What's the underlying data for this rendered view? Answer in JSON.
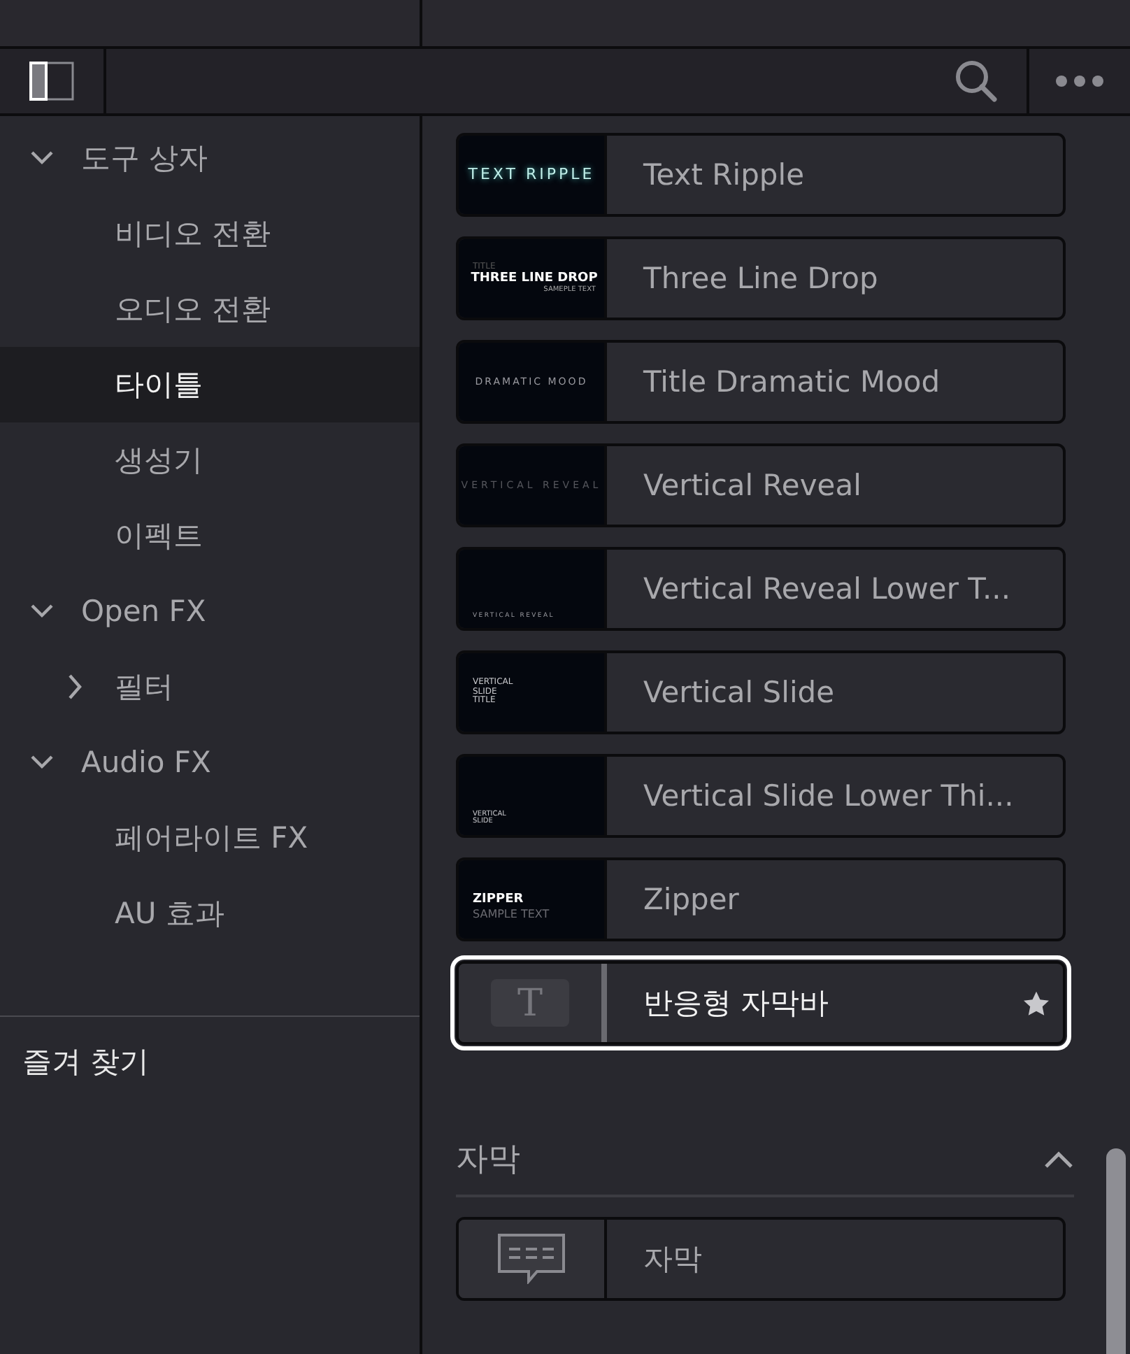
{
  "sidebar": {
    "tree": [
      {
        "label": "도구 상자",
        "expanded": true,
        "selected": false,
        "children": [
          {
            "label": "비디오 전환",
            "selected": false
          },
          {
            "label": "오디오 전환",
            "selected": false
          },
          {
            "label": "타이틀",
            "selected": true
          },
          {
            "label": "생성기",
            "selected": false
          },
          {
            "label": "이펙트",
            "selected": false
          }
        ]
      },
      {
        "label": "Open FX",
        "expanded": true,
        "selected": false,
        "children": [
          {
            "label": "필터",
            "expanded": false,
            "selected": false
          }
        ]
      },
      {
        "label": "Audio FX",
        "expanded": true,
        "selected": false,
        "children": [
          {
            "label": "페어라이트 FX",
            "selected": false
          },
          {
            "label": "AU 효과",
            "selected": false
          }
        ]
      }
    ],
    "favorites": "즐겨 찾기"
  },
  "items": [
    {
      "name": "Text Ripple",
      "selected": false,
      "favorite": false,
      "thumb": {
        "kind": "glow",
        "lines": [
          "TEXT RIPPLE"
        ]
      }
    },
    {
      "name": "Three Line Drop",
      "selected": false,
      "favorite": false,
      "thumb": {
        "kind": "three-line",
        "lines": [
          "TITLE",
          "THREE LINE DROP",
          "SAMEPLE  TEXT"
        ]
      }
    },
    {
      "name": "Title Dramatic Mood",
      "selected": false,
      "favorite": false,
      "thumb": {
        "kind": "spaced",
        "lines": [
          "DRAMATIC MOOD"
        ]
      }
    },
    {
      "name": "Vertical Reveal",
      "selected": false,
      "favorite": false,
      "thumb": {
        "kind": "faded",
        "lines": [
          "VERTICAL REVEAL"
        ]
      }
    },
    {
      "name": "Vertical Reveal Lower T...",
      "selected": false,
      "favorite": false,
      "thumb": {
        "kind": "tiny-bottom",
        "lines": [
          "VERTICAL REVEAL"
        ]
      }
    },
    {
      "name": "Vertical Slide",
      "selected": false,
      "favorite": false,
      "thumb": {
        "kind": "stack",
        "lines": [
          "VERTICAL",
          "SLIDE",
          "TITLE"
        ]
      }
    },
    {
      "name": "Vertical Slide Lower Thi...",
      "selected": false,
      "favorite": false,
      "thumb": {
        "kind": "stack-bottom",
        "lines": [
          "VERTICAL",
          "SLIDE"
        ]
      }
    },
    {
      "name": "Zipper",
      "selected": false,
      "favorite": false,
      "thumb": {
        "kind": "bold-sub",
        "lines": [
          "ZIPPER",
          "SAMPLE TEXT"
        ]
      }
    },
    {
      "name": "반응형 자막바",
      "selected": true,
      "favorite": true,
      "thumb": {
        "kind": "letter-icon",
        "lines": [
          "T"
        ]
      }
    }
  ],
  "sections": [
    {
      "title": "자막",
      "expanded": true,
      "items": [
        {
          "name": "자막",
          "selected": false,
          "favorite": false,
          "thumb": {
            "kind": "caption-icon"
          }
        }
      ]
    }
  ]
}
